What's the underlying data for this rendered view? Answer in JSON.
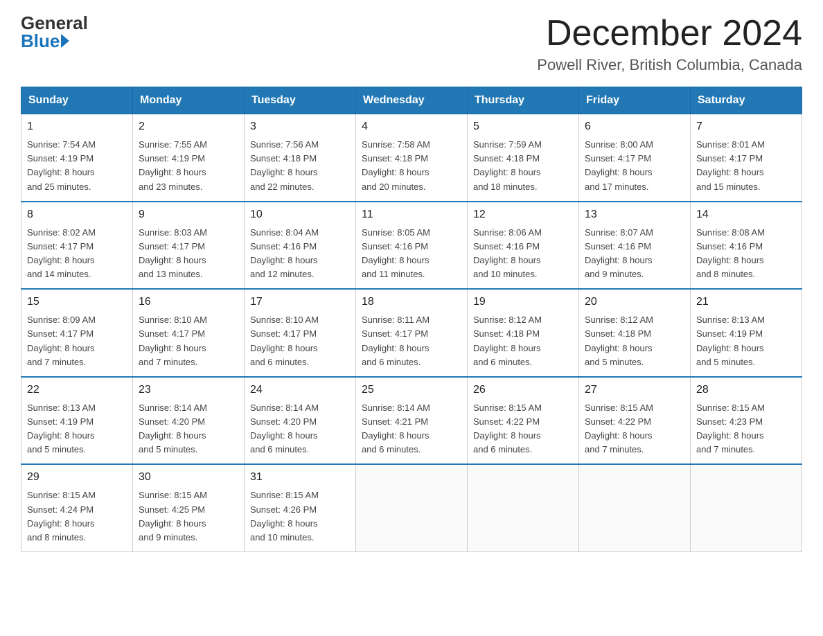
{
  "header": {
    "logo_general": "General",
    "logo_blue": "Blue",
    "month_title": "December 2024",
    "location": "Powell River, British Columbia, Canada"
  },
  "weekdays": [
    "Sunday",
    "Monday",
    "Tuesday",
    "Wednesday",
    "Thursday",
    "Friday",
    "Saturday"
  ],
  "weeks": [
    [
      {
        "day": "1",
        "sunrise": "7:54 AM",
        "sunset": "4:19 PM",
        "daylight": "8 hours and 25 minutes."
      },
      {
        "day": "2",
        "sunrise": "7:55 AM",
        "sunset": "4:19 PM",
        "daylight": "8 hours and 23 minutes."
      },
      {
        "day": "3",
        "sunrise": "7:56 AM",
        "sunset": "4:18 PM",
        "daylight": "8 hours and 22 minutes."
      },
      {
        "day": "4",
        "sunrise": "7:58 AM",
        "sunset": "4:18 PM",
        "daylight": "8 hours and 20 minutes."
      },
      {
        "day": "5",
        "sunrise": "7:59 AM",
        "sunset": "4:18 PM",
        "daylight": "8 hours and 18 minutes."
      },
      {
        "day": "6",
        "sunrise": "8:00 AM",
        "sunset": "4:17 PM",
        "daylight": "8 hours and 17 minutes."
      },
      {
        "day": "7",
        "sunrise": "8:01 AM",
        "sunset": "4:17 PM",
        "daylight": "8 hours and 15 minutes."
      }
    ],
    [
      {
        "day": "8",
        "sunrise": "8:02 AM",
        "sunset": "4:17 PM",
        "daylight": "8 hours and 14 minutes."
      },
      {
        "day": "9",
        "sunrise": "8:03 AM",
        "sunset": "4:17 PM",
        "daylight": "8 hours and 13 minutes."
      },
      {
        "day": "10",
        "sunrise": "8:04 AM",
        "sunset": "4:16 PM",
        "daylight": "8 hours and 12 minutes."
      },
      {
        "day": "11",
        "sunrise": "8:05 AM",
        "sunset": "4:16 PM",
        "daylight": "8 hours and 11 minutes."
      },
      {
        "day": "12",
        "sunrise": "8:06 AM",
        "sunset": "4:16 PM",
        "daylight": "8 hours and 10 minutes."
      },
      {
        "day": "13",
        "sunrise": "8:07 AM",
        "sunset": "4:16 PM",
        "daylight": "8 hours and 9 minutes."
      },
      {
        "day": "14",
        "sunrise": "8:08 AM",
        "sunset": "4:16 PM",
        "daylight": "8 hours and 8 minutes."
      }
    ],
    [
      {
        "day": "15",
        "sunrise": "8:09 AM",
        "sunset": "4:17 PM",
        "daylight": "8 hours and 7 minutes."
      },
      {
        "day": "16",
        "sunrise": "8:10 AM",
        "sunset": "4:17 PM",
        "daylight": "8 hours and 7 minutes."
      },
      {
        "day": "17",
        "sunrise": "8:10 AM",
        "sunset": "4:17 PM",
        "daylight": "8 hours and 6 minutes."
      },
      {
        "day": "18",
        "sunrise": "8:11 AM",
        "sunset": "4:17 PM",
        "daylight": "8 hours and 6 minutes."
      },
      {
        "day": "19",
        "sunrise": "8:12 AM",
        "sunset": "4:18 PM",
        "daylight": "8 hours and 6 minutes."
      },
      {
        "day": "20",
        "sunrise": "8:12 AM",
        "sunset": "4:18 PM",
        "daylight": "8 hours and 5 minutes."
      },
      {
        "day": "21",
        "sunrise": "8:13 AM",
        "sunset": "4:19 PM",
        "daylight": "8 hours and 5 minutes."
      }
    ],
    [
      {
        "day": "22",
        "sunrise": "8:13 AM",
        "sunset": "4:19 PM",
        "daylight": "8 hours and 5 minutes."
      },
      {
        "day": "23",
        "sunrise": "8:14 AM",
        "sunset": "4:20 PM",
        "daylight": "8 hours and 5 minutes."
      },
      {
        "day": "24",
        "sunrise": "8:14 AM",
        "sunset": "4:20 PM",
        "daylight": "8 hours and 6 minutes."
      },
      {
        "day": "25",
        "sunrise": "8:14 AM",
        "sunset": "4:21 PM",
        "daylight": "8 hours and 6 minutes."
      },
      {
        "day": "26",
        "sunrise": "8:15 AM",
        "sunset": "4:22 PM",
        "daylight": "8 hours and 6 minutes."
      },
      {
        "day": "27",
        "sunrise": "8:15 AM",
        "sunset": "4:22 PM",
        "daylight": "8 hours and 7 minutes."
      },
      {
        "day": "28",
        "sunrise": "8:15 AM",
        "sunset": "4:23 PM",
        "daylight": "8 hours and 7 minutes."
      }
    ],
    [
      {
        "day": "29",
        "sunrise": "8:15 AM",
        "sunset": "4:24 PM",
        "daylight": "8 hours and 8 minutes."
      },
      {
        "day": "30",
        "sunrise": "8:15 AM",
        "sunset": "4:25 PM",
        "daylight": "8 hours and 9 minutes."
      },
      {
        "day": "31",
        "sunrise": "8:15 AM",
        "sunset": "4:26 PM",
        "daylight": "8 hours and 10 minutes."
      },
      null,
      null,
      null,
      null
    ]
  ],
  "labels": {
    "sunrise": "Sunrise:",
    "sunset": "Sunset:",
    "daylight": "Daylight:"
  }
}
